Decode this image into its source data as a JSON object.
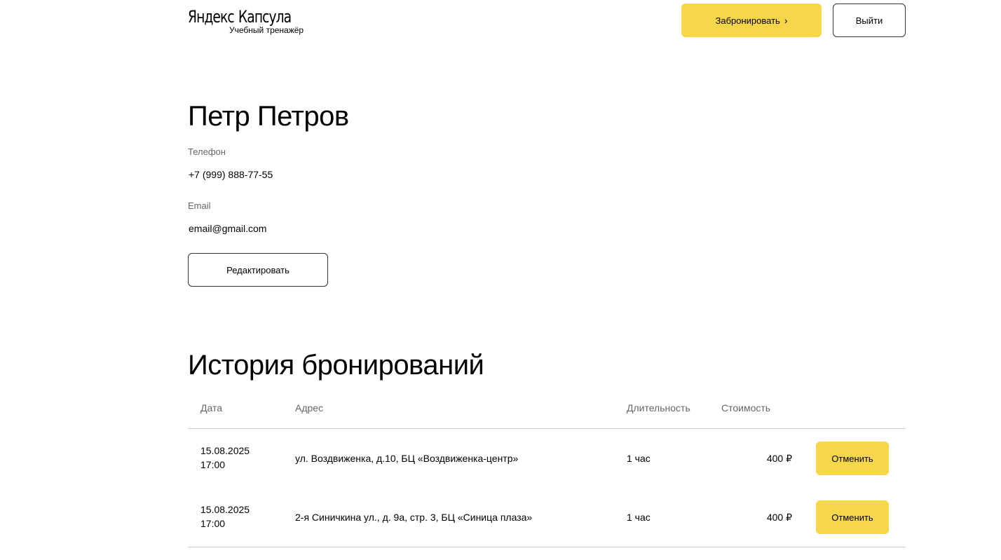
{
  "header": {
    "logo_brand": "Яндекс",
    "logo_product": "Капсула",
    "logo_subtitle": "Учебный тренажёр",
    "book_label": "Забронировать",
    "book_chevron": "›",
    "logout_label": "Выйти"
  },
  "profile": {
    "name": "Петр Петров",
    "phone_label": "Телефон",
    "phone_value": "+7 (999) 888-77-55",
    "email_label": "Email",
    "email_value": "email@gmail.com",
    "edit_label": "Редактировать"
  },
  "history": {
    "title": "История бронирований",
    "columns": {
      "date": "Дата",
      "address": "Адрес",
      "duration": "Длительность",
      "cost": "Стоимость"
    },
    "rows": [
      {
        "date": "15.08.2025",
        "time": "17:00",
        "address": "ул. Воздвиженка, д.10, БЦ «Воздвиженка-центр»",
        "duration": "1 час",
        "cost": "400 ₽",
        "cancel_label": "Отменить"
      },
      {
        "date": "15.08.2025",
        "time": "17:00",
        "address": "2-я Синичкина ул., д. 9а, стр. 3, БЦ «Синица плаза»",
        "duration": "1 час",
        "cost": "400 ₽",
        "cancel_label": "Отменить"
      }
    ]
  },
  "colors": {
    "accent_yellow": "#f6d74a",
    "text_primary": "#000000",
    "text_secondary": "#666666",
    "divider": "#cccccc",
    "outline_border": "#333333"
  },
  "icons": {
    "book_button_icon": "chevron-right-icon"
  }
}
